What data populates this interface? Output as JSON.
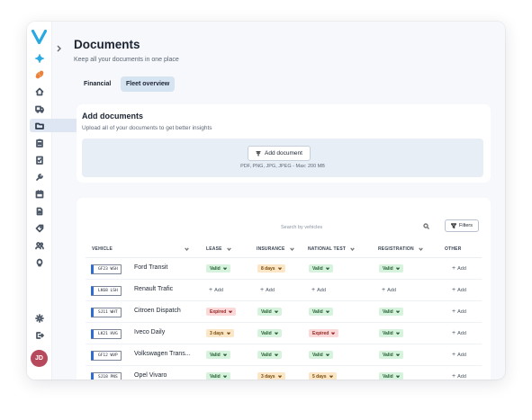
{
  "app": {
    "logo_letter": "V",
    "user_initials": "JD",
    "brand_color": "#29a9e1",
    "nav_icons": [
      "sparkle-icon",
      "link-icon",
      "home-icon",
      "truck-icon",
      "folder-icon",
      "clipboard-icon",
      "checklist-icon",
      "wrench-icon",
      "calendar-icon",
      "document-icon",
      "tag-icon",
      "people-icon",
      "bulb-icon"
    ],
    "active_nav": "folder-icon",
    "bottom_icons": [
      "gear-icon",
      "logout-icon"
    ]
  },
  "page": {
    "title": "Documents",
    "subtitle": "Keep all your documents in one place",
    "tabs": [
      {
        "label": "Financial",
        "active": false
      },
      {
        "label": "Fleet overview",
        "active": true
      }
    ]
  },
  "upload": {
    "title": "Add documents",
    "description": "Upload all of your documents to get better insights",
    "button_label": "Add document",
    "hint": "PDF, PNG, JPG, JPEG - Max: 200 MB"
  },
  "table": {
    "search_placeholder": "Search by vehicles",
    "filters_label": "Filters",
    "columns": [
      "VEHICLE",
      "LEASE",
      "INSURANCE",
      "NATIONAL TEST",
      "REGISTRATION",
      "OTHER"
    ],
    "add_label": "Add",
    "rows": [
      {
        "plate": "GF23 WSH",
        "name": "Ford Transit",
        "lease": {
          "label": "Valid",
          "status": "valid"
        },
        "insurance": {
          "label": "8 days",
          "status": "warn"
        },
        "national_test": {
          "label": "Valid",
          "status": "valid"
        },
        "registration": {
          "label": "Valid",
          "status": "valid"
        },
        "other": null
      },
      {
        "plate": "LK68 LSH",
        "name": "Renault Trafic",
        "lease": null,
        "insurance": null,
        "national_test": null,
        "registration": null,
        "other": null
      },
      {
        "plate": "SJ11 WHT",
        "name": "Citroen Dispatch",
        "lease": {
          "label": "Expired",
          "status": "expired"
        },
        "insurance": {
          "label": "Valid",
          "status": "valid"
        },
        "national_test": {
          "label": "Valid",
          "status": "valid"
        },
        "registration": {
          "label": "Valid",
          "status": "valid"
        },
        "other": null
      },
      {
        "plate": "LK21 HVG",
        "name": "Iveco Daily",
        "lease": {
          "label": "3 days",
          "status": "warn"
        },
        "insurance": {
          "label": "Valid",
          "status": "valid"
        },
        "national_test": {
          "label": "Expired",
          "status": "expired"
        },
        "registration": {
          "label": "Valid",
          "status": "valid"
        },
        "other": null
      },
      {
        "plate": "GF12 WVP",
        "name": "Volkswagen Trans...",
        "lease": {
          "label": "Valid",
          "status": "valid"
        },
        "insurance": {
          "label": "Valid",
          "status": "valid"
        },
        "national_test": {
          "label": "Valid",
          "status": "valid"
        },
        "registration": {
          "label": "Valid",
          "status": "valid"
        },
        "other": null
      },
      {
        "plate": "SJ18 PNS",
        "name": "Opel Vivaro",
        "lease": {
          "label": "Valid",
          "status": "valid"
        },
        "insurance": {
          "label": "3 days",
          "status": "warn"
        },
        "national_test": {
          "label": "5 days",
          "status": "warn"
        },
        "registration": {
          "label": "Valid",
          "status": "valid"
        },
        "other": null
      }
    ]
  }
}
